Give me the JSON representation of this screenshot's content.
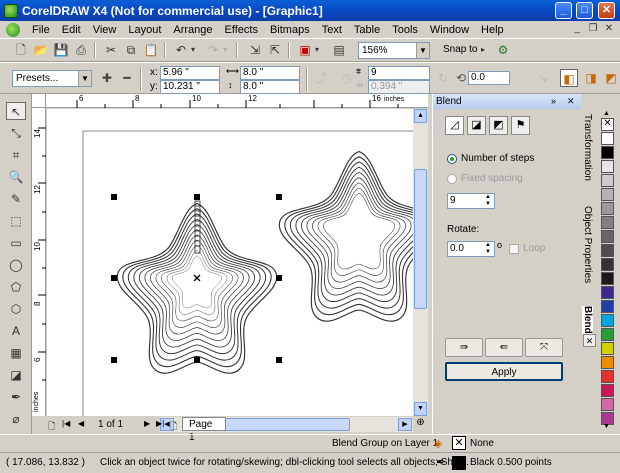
{
  "window": {
    "title": "CorelDRAW X4 (Not for commercial use) - [Graphic1]",
    "minimize": "_",
    "maximize": "□",
    "close": "✕"
  },
  "menu": [
    "File",
    "Edit",
    "View",
    "Layout",
    "Arrange",
    "Effects",
    "Bitmaps",
    "Text",
    "Table",
    "Tools",
    "Window",
    "Help"
  ],
  "standard_toolbar": {
    "zoom": "156%",
    "snap_to": "Snap to"
  },
  "property_bar": {
    "presets": "Presets...",
    "x_label": "x:",
    "x_value": "5.96 \"",
    "y_label": "y:",
    "y_value": "10.231 \"",
    "width_value": "8.0 \"",
    "height_value": "8.0 \"",
    "steps_value": "9",
    "spacing_value": "0.394 \"",
    "rotation_value": "0.0"
  },
  "rulers": {
    "h_ticks": [
      "6",
      "8",
      "10",
      "12",
      "inches",
      "16"
    ],
    "v_ticks": [
      "14",
      "12",
      "10",
      "8",
      "6",
      "inches"
    ]
  },
  "page_nav": {
    "counter": "1 of 1",
    "page_tab": "Page 1"
  },
  "docker": {
    "title": "Blend",
    "number_of_steps": "Number of steps",
    "fixed_spacing": "Fixed spacing",
    "steps_value": "9",
    "rotate_label": "Rotate:",
    "rotate_value": "0.0",
    "rotate_unit": "o",
    "loop_label": "Loop",
    "apply": "Apply"
  },
  "vertical_tabs": [
    "Transformation",
    "Object Properties",
    "Blend"
  ],
  "palette_colors": [
    "#ffffff",
    "#000000",
    "#e6e6e6",
    "#cccccc",
    "#b3b3b3",
    "#999999",
    "#808080",
    "#666666",
    "#4d4d4d",
    "#333333",
    "#1a1a1a",
    "#3a2a8c",
    "#1f3ea8",
    "#00a3dd",
    "#2b9a3a",
    "#d0d000",
    "#f08c00",
    "#e33030",
    "#c8185c",
    "#d06aa8",
    "#a83890"
  ],
  "status": {
    "object_info": "Blend Group on Layer 1",
    "fill": "None",
    "outline": "Black  0.500 points",
    "coords": "( 17.086, 13.832 )",
    "hint": "Click an object twice for rotating/skewing; dbl-clicking tool selects all objects; Shift..."
  },
  "accent": "#0a46c0"
}
